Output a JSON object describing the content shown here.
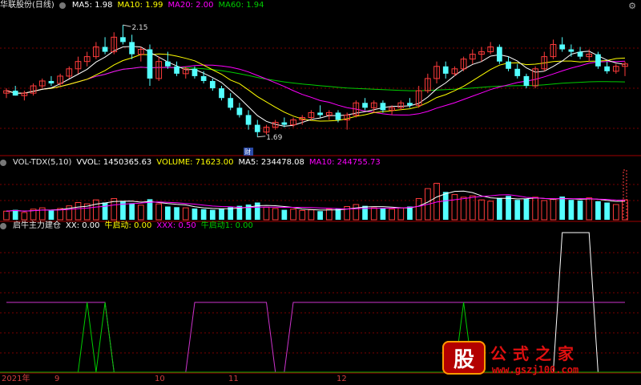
{
  "colors": {
    "up": "#ff3b3b",
    "down": "#54ffff",
    "ma5": "#ffffff",
    "ma10": "#ffff00",
    "ma20": "#ff00ff",
    "ma60": "#00cc00",
    "grid": "#7a0000",
    "axis": "#a00000"
  },
  "price_header": {
    "stock": "华联股份(日线)",
    "ma5": "MA5: 1.98",
    "ma10": "MA10: 1.99",
    "ma20": "MA20: 2.00",
    "ma60": "MA60: 1.94"
  },
  "vol_header": {
    "name": "VOL-TDX(5,10)",
    "vvol": "VVOL: 1450365.63",
    "volume": "VOLUME: 71623.00",
    "ma5": "MA5: 234478.08",
    "ma10": "MA10: 244755.73"
  },
  "ind_header": {
    "name": "启牛主力建仓",
    "xx": "XX: 0.00",
    "niu": "牛启动: 0.00",
    "xxx": "XXX: 0.50",
    "niu1": "牛启动1: 0.00"
  },
  "annotations": {
    "high": "2.15",
    "low": "1.69",
    "cai": "财"
  },
  "x_axis": {
    "year": "2021年",
    "m9": "9",
    "m10": "10",
    "m11": "11",
    "m12": "12"
  },
  "logo": {
    "badge": "股",
    "cn": "公式之家",
    "url": "www.gszj100.com"
  },
  "chart_data": [
    {
      "type": "candlestick",
      "title": "华联股份(日线)",
      "y_range": [
        1.62,
        2.2
      ],
      "annotations": [
        {
          "label": "2.15",
          "value": 2.15
        },
        {
          "label": "1.69",
          "value": 1.69
        }
      ],
      "ohlc": [
        [
          1.87,
          1.89,
          1.85,
          1.88
        ],
        [
          1.88,
          1.9,
          1.86,
          1.86
        ],
        [
          1.86,
          1.88,
          1.84,
          1.87
        ],
        [
          1.87,
          1.91,
          1.86,
          1.9
        ],
        [
          1.9,
          1.93,
          1.89,
          1.92
        ],
        [
          1.92,
          1.94,
          1.9,
          1.91
        ],
        [
          1.91,
          1.95,
          1.9,
          1.94
        ],
        [
          1.94,
          1.98,
          1.93,
          1.97
        ],
        [
          1.97,
          2.02,
          1.95,
          2.0
        ],
        [
          2.0,
          2.04,
          1.98,
          2.02
        ],
        [
          2.02,
          2.08,
          2.01,
          2.06
        ],
        [
          2.06,
          2.1,
          2.03,
          2.04
        ],
        [
          2.04,
          2.12,
          2.03,
          2.1
        ],
        [
          2.1,
          2.15,
          2.07,
          2.08
        ],
        [
          2.08,
          2.11,
          2.01,
          2.03
        ],
        [
          2.03,
          2.06,
          2.0,
          2.05
        ],
        [
          2.05,
          2.07,
          1.9,
          1.93
        ],
        [
          1.93,
          2.02,
          1.92,
          2.0
        ],
        [
          2.0,
          2.04,
          1.97,
          1.98
        ],
        [
          1.98,
          2.0,
          1.94,
          1.95
        ],
        [
          1.95,
          1.98,
          1.93,
          1.97
        ],
        [
          1.97,
          1.98,
          1.93,
          1.94
        ],
        [
          1.94,
          1.96,
          1.91,
          1.92
        ],
        [
          1.92,
          1.93,
          1.88,
          1.89
        ],
        [
          1.89,
          1.9,
          1.84,
          1.85
        ],
        [
          1.85,
          1.87,
          1.8,
          1.81
        ],
        [
          1.81,
          1.83,
          1.77,
          1.78
        ],
        [
          1.78,
          1.8,
          1.72,
          1.74
        ],
        [
          1.74,
          1.76,
          1.69,
          1.71
        ],
        [
          1.71,
          1.74,
          1.7,
          1.73
        ],
        [
          1.73,
          1.76,
          1.72,
          1.75
        ],
        [
          1.75,
          1.77,
          1.73,
          1.74
        ],
        [
          1.74,
          1.77,
          1.73,
          1.76
        ],
        [
          1.76,
          1.78,
          1.74,
          1.77
        ],
        [
          1.77,
          1.8,
          1.76,
          1.79
        ],
        [
          1.79,
          1.82,
          1.77,
          1.78
        ],
        [
          1.78,
          1.8,
          1.76,
          1.79
        ],
        [
          1.79,
          1.8,
          1.75,
          1.76
        ],
        [
          1.76,
          1.79,
          1.72,
          1.78
        ],
        [
          1.78,
          1.84,
          1.77,
          1.83
        ],
        [
          1.83,
          1.85,
          1.8,
          1.81
        ],
        [
          1.81,
          1.84,
          1.79,
          1.83
        ],
        [
          1.83,
          1.84,
          1.79,
          1.8
        ],
        [
          1.8,
          1.82,
          1.78,
          1.81
        ],
        [
          1.81,
          1.84,
          1.8,
          1.83
        ],
        [
          1.83,
          1.85,
          1.81,
          1.82
        ],
        [
          1.82,
          1.9,
          1.81,
          1.88
        ],
        [
          1.88,
          1.95,
          1.87,
          1.93
        ],
        [
          1.93,
          2.0,
          1.91,
          1.98
        ],
        [
          1.98,
          2.0,
          1.93,
          1.95
        ],
        [
          1.95,
          1.98,
          1.94,
          1.97
        ],
        [
          1.97,
          2.02,
          1.96,
          2.01
        ],
        [
          2.01,
          2.05,
          1.99,
          2.03
        ],
        [
          2.03,
          2.06,
          2.0,
          2.04
        ],
        [
          2.04,
          2.08,
          2.03,
          2.06
        ],
        [
          2.06,
          2.07,
          1.99,
          2.0
        ],
        [
          2.0,
          2.02,
          1.96,
          1.97
        ],
        [
          1.97,
          1.99,
          1.93,
          1.94
        ],
        [
          1.94,
          1.95,
          1.89,
          1.9
        ],
        [
          1.9,
          1.98,
          1.89,
          1.97
        ],
        [
          1.97,
          2.04,
          1.96,
          2.02
        ],
        [
          2.02,
          2.09,
          2.01,
          2.07
        ],
        [
          2.07,
          2.1,
          2.04,
          2.05
        ],
        [
          2.05,
          2.07,
          2.02,
          2.04
        ],
        [
          2.04,
          2.06,
          2.01,
          2.02
        ],
        [
          2.02,
          2.05,
          2.0,
          2.03
        ],
        [
          2.03,
          2.04,
          1.97,
          1.98
        ],
        [
          1.98,
          2.0,
          1.95,
          1.96
        ],
        [
          1.96,
          1.99,
          1.95,
          1.98
        ],
        [
          1.98,
          2.0,
          1.94,
          1.99
        ]
      ]
    },
    {
      "type": "bar",
      "title": "VOL-TDX(5,10)",
      "y_range": [
        0,
        1500000
      ],
      "values": [
        130000,
        150000,
        110000,
        160000,
        180000,
        140000,
        170000,
        210000,
        260000,
        240000,
        300000,
        260000,
        320000,
        280000,
        250000,
        220000,
        310000,
        240000,
        200000,
        190000,
        180000,
        170000,
        160000,
        150000,
        170000,
        190000,
        210000,
        230000,
        260000,
        190000,
        170000,
        150000,
        160000,
        140000,
        150000,
        130000,
        160000,
        170000,
        200000,
        230000,
        210000,
        180000,
        170000,
        160000,
        180000,
        200000,
        320000,
        470000,
        550000,
        420000,
        380000,
        340000,
        360000,
        300000,
        280000,
        330000,
        360000,
        300000,
        320000,
        340000,
        290000,
        310000,
        350000,
        300000,
        290000,
        330000,
        280000,
        260000,
        230000,
        300000
      ],
      "direction": [
        1,
        0,
        1,
        1,
        1,
        0,
        1,
        1,
        1,
        1,
        1,
        0,
        1,
        0,
        0,
        1,
        0,
        1,
        0,
        0,
        1,
        0,
        0,
        0,
        0,
        0,
        0,
        0,
        0,
        1,
        1,
        0,
        1,
        1,
        1,
        0,
        1,
        0,
        1,
        1,
        0,
        1,
        0,
        1,
        1,
        0,
        1,
        1,
        1,
        0,
        1,
        1,
        1,
        1,
        1,
        0,
        0,
        0,
        0,
        1,
        1,
        1,
        0,
        0,
        0,
        1,
        0,
        0,
        1,
        1
      ]
    },
    {
      "type": "line",
      "title": "启牛主力建仓",
      "y_range": [
        0,
        1
      ],
      "series": [
        {
          "name": "XX",
          "values": [
            0,
            0,
            0,
            0,
            0,
            0,
            0,
            0,
            0,
            0,
            0,
            0,
            0,
            0,
            0,
            0,
            0,
            0,
            0,
            0,
            0,
            0,
            0,
            0,
            0,
            0,
            0,
            0,
            0,
            0,
            0,
            0,
            0,
            0,
            0,
            0,
            0,
            0,
            0,
            0,
            0,
            0,
            0,
            0,
            0,
            0,
            0,
            0,
            0,
            0,
            0,
            0,
            0,
            0,
            0,
            0,
            0,
            0,
            0,
            0,
            0,
            0,
            1,
            1,
            1,
            1,
            0,
            0,
            0,
            0
          ]
        },
        {
          "name": "XXX",
          "values": [
            0.5,
            0.5,
            0.5,
            0.5,
            0.5,
            0.5,
            0.5,
            0.5,
            0.5,
            0.5,
            0.5,
            0.5,
            0,
            0,
            0,
            0,
            0,
            0,
            0,
            0,
            0,
            0.5,
            0.5,
            0.5,
            0.5,
            0.5,
            0.5,
            0.5,
            0.5,
            0.5,
            0,
            0,
            0.5,
            0.5,
            0.5,
            0.5,
            0.5,
            0.5,
            0.5,
            0.5,
            0.5,
            0.5,
            0.5,
            0.5,
            0.5,
            0.5,
            0.5,
            0.5,
            0.5,
            0.5,
            0.5,
            0.5,
            0.5,
            0.5,
            0.5,
            0.5,
            0.5,
            0.5,
            0.5,
            0.5,
            0.5,
            0.5,
            0.5,
            0.5,
            0.5,
            0.5,
            0.5,
            0.5,
            0.5,
            0.5
          ]
        },
        {
          "name": "牛启动1",
          "values": [
            0,
            0,
            0,
            0,
            0,
            0,
            0,
            0,
            0,
            0.5,
            0,
            0.5,
            0,
            0,
            0,
            0,
            0,
            0,
            0,
            0,
            0,
            0,
            0,
            0,
            0,
            0,
            0,
            0,
            0,
            0,
            0,
            0,
            0,
            0,
            0,
            0,
            0,
            0,
            0,
            0,
            0,
            0,
            0,
            0,
            0,
            0,
            0,
            0,
            0,
            0,
            0,
            0.5,
            0,
            0,
            0,
            0,
            0,
            0,
            0,
            0,
            0,
            0,
            0,
            0,
            0,
            0,
            0,
            0,
            0,
            0
          ]
        }
      ]
    }
  ]
}
